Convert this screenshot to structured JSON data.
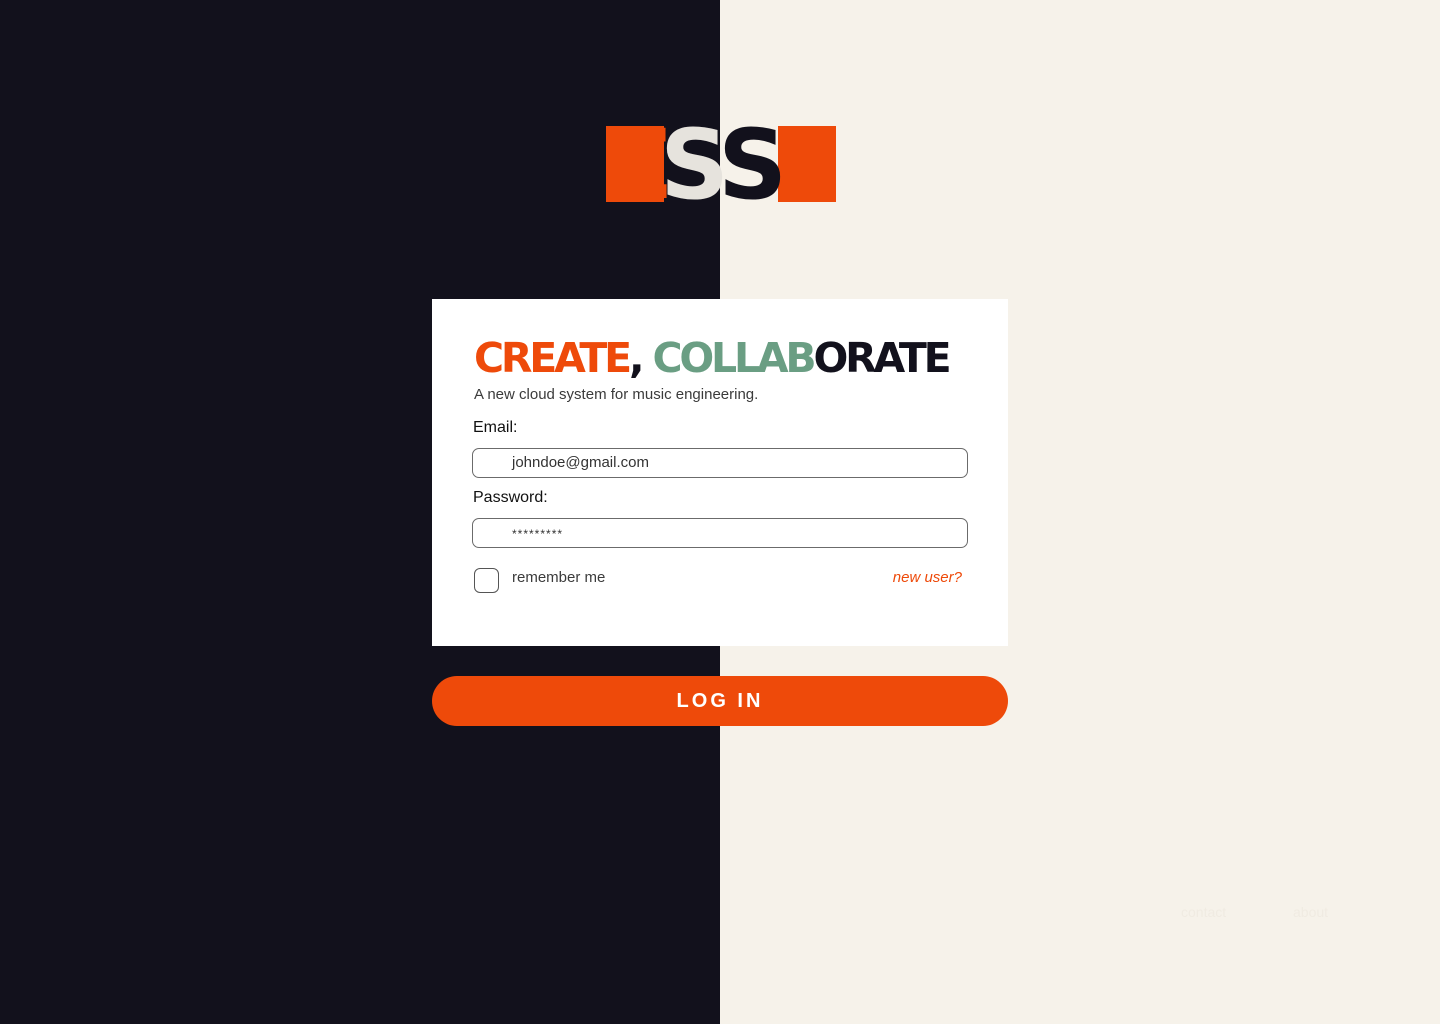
{
  "logo": {
    "letters": [
      "E",
      "S",
      "S",
      "E"
    ],
    "colors": {
      "orange": "#ee4a0a",
      "light": "#e6e3dd",
      "dark": "#12111c"
    }
  },
  "colors": {
    "left_panel": "#12111c",
    "right_panel": "#f6f2ea",
    "accent": "#ee4a0a",
    "green": "#6a9e83"
  },
  "headline": {
    "part1": "CREATE",
    "part2": ",",
    "part3": "COLLAB",
    "part4": "ORATE"
  },
  "tagline": "A new cloud system for music engineering.",
  "form": {
    "email_label": "Email:",
    "email_value": "johndoe@gmail.com",
    "password_label": "Password:",
    "password_value": "*********",
    "remember_label": "remember me",
    "remember_checked": false,
    "new_user_link": "new user?"
  },
  "login_button": "LOG IN",
  "footer": {
    "contact": "contact",
    "about": "about"
  }
}
